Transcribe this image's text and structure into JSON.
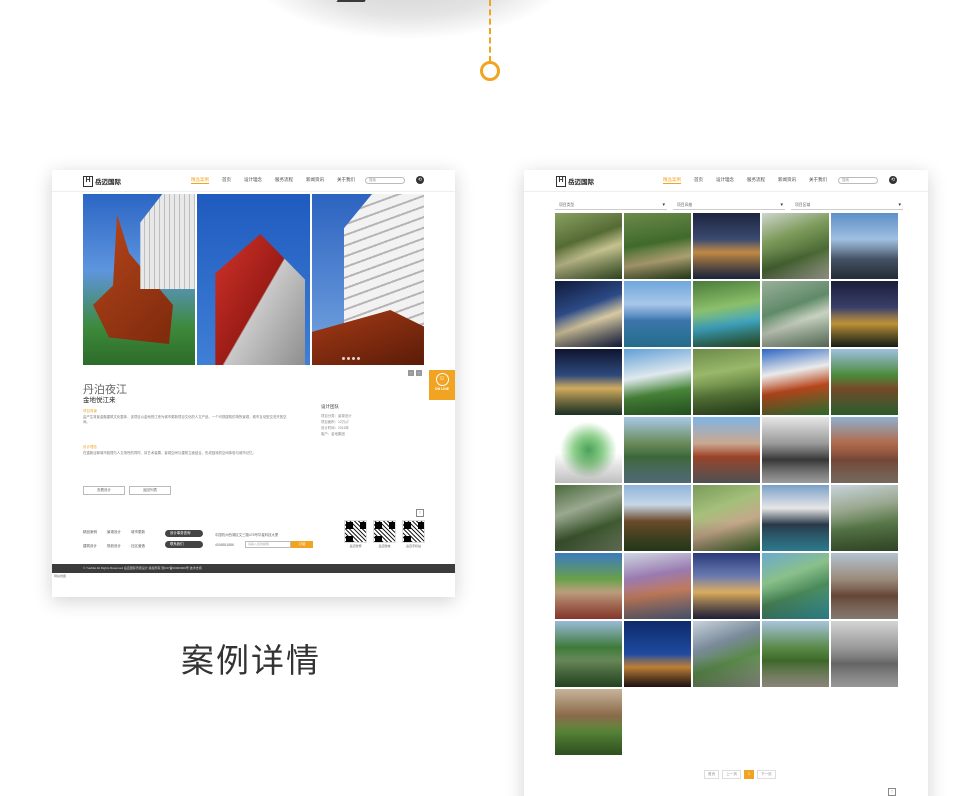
{
  "colors": {
    "accent": "#f0a422",
    "dark": "#3b3b3b"
  },
  "logo_text": "岳迈国际",
  "nav": [
    "首页",
    "精品案例",
    "设计理念",
    "服务流程",
    "新闻资讯",
    "关于我们"
  ],
  "nav_active_index": 1,
  "search_placeholder": "搜索",
  "detail": {
    "case_title": "丹泊夜江",
    "case_subtitle": "金地悦江来",
    "section1_label": "项目背景",
    "section1_text": "由产生背景金融建筑文化整体，该项目以金地悦江来为城市更新项目文化的人文产品，一个可视感知的场所景观，城市互动型交流开放空间。",
    "section2_label": "设计理念",
    "section2_text": "在重新诠释城市肌理与人文场所的同时，将艺术装置、景观空间与建筑立面结合，形成独特的空间体验与城市记忆。",
    "btn_prev": "查看设计",
    "btn_next": "返回列表",
    "info_title": "设计团队",
    "info_lines": [
      "项目分类：景观设计",
      "项目面积：12万㎡",
      "设计时间：2016年",
      "客户：金地集团"
    ],
    "online_label": "ON LINE",
    "footer_links": [
      "精品案例",
      "景观设计",
      "城市更新",
      "建筑设计",
      "规划设计",
      "社区营造"
    ],
    "footer_pill1": "设计事务咨询",
    "footer_pill2": "联系我们",
    "footer_addr": "中国杭州西湖区文三路478号华星科技大厦",
    "footer_phone": "4006551886",
    "footer_input_placeholder": "请输入您的邮箱",
    "footer_submit": "订阅",
    "qr_labels": [
      "岳迈微博",
      "岳迈微信",
      "岳迈手机站"
    ],
    "copyright": "© YueMai All Rights Reserved 岳迈国际景观设计 版权所有 浙ICP备00000000号 技术支持",
    "footer_small": "网站地图"
  },
  "list": {
    "filters": [
      "项目类型",
      "项目风格",
      "项目区域"
    ],
    "pager": [
      "首页",
      "上一页",
      "1",
      "下一页"
    ],
    "pager_active_index": 2
  },
  "caption": "案例详情"
}
